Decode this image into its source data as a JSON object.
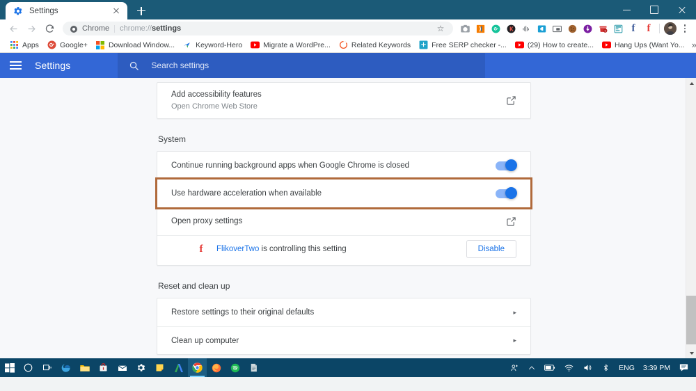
{
  "window": {
    "tab": {
      "title": "Settings",
      "favicon": "gear-icon"
    },
    "new_tab_label": "+",
    "controls": {
      "minimize": "–",
      "maximize": "❐",
      "close": "×"
    }
  },
  "toolbar": {
    "back": "back-arrow",
    "forward": "forward-arrow",
    "reload": "reload-arrow",
    "omnibox": {
      "scheme_label": "Chrome",
      "url_prefix": "chrome://",
      "url_bold": "settings",
      "full_url": "chrome://settings",
      "star": "☆"
    },
    "extensions": [
      {
        "name": "camera-extension-icon",
        "glyph": "📷",
        "color": "#9aa0a6"
      },
      {
        "name": "orange-extension-icon",
        "glyph": "",
        "color": "#f57c00"
      },
      {
        "name": "grammarly-extension-icon",
        "glyph": "G",
        "color": "#15c39a"
      },
      {
        "name": "dark-circle-extension-icon",
        "glyph": "K",
        "color": "#202124"
      },
      {
        "name": "audio-wave-extension-icon",
        "glyph": "",
        "color": "#5f6368"
      },
      {
        "name": "send-to-device-extension-icon",
        "glyph": "",
        "color": "#1a9fd4"
      },
      {
        "name": "picture-in-picture-extension-icon",
        "glyph": "",
        "color": "#5f6368"
      },
      {
        "name": "cookie-extension-icon",
        "glyph": "",
        "color": "#a0522d"
      },
      {
        "name": "download-extension-icon",
        "glyph": "↓",
        "color": "#7b1fa2"
      },
      {
        "name": "red-badge-extension-icon",
        "glyph": "",
        "color": "#d32f2f"
      },
      {
        "name": "blue-form-extension-icon",
        "glyph": "",
        "color": "#2196a6"
      },
      {
        "name": "facebook-f-extension-icon",
        "glyph": "f",
        "color": "#3b5998"
      },
      {
        "name": "flikover-f-extension-icon",
        "glyph": "f",
        "color": "#e53935"
      }
    ],
    "avatar": "user-avatar",
    "menu": "three-dot-menu"
  },
  "bookmarks": {
    "items": [
      {
        "label": "Apps",
        "icon": "apps-grid-icon"
      },
      {
        "label": "Google+",
        "icon": "google-plus-icon"
      },
      {
        "label": "Download Window...",
        "icon": "microsoft-windows-icon"
      },
      {
        "label": "Keyword-Hero",
        "icon": "keyword-hero-icon"
      },
      {
        "label": "Migrate a WordPre...",
        "icon": "youtube-icon"
      },
      {
        "label": "Related Keywords",
        "icon": "orange-ring-icon"
      },
      {
        "label": "Free SERP checker -...",
        "icon": "serp-checker-icon"
      },
      {
        "label": "(29) How to create...",
        "icon": "youtube-icon"
      },
      {
        "label": "Hang Ups (Want Yo...",
        "icon": "youtube-icon"
      }
    ],
    "overflow": "»"
  },
  "settings_header": {
    "menu_icon": "hamburger-menu-icon",
    "title": "Settings",
    "search": {
      "icon": "search-icon",
      "placeholder": "Search settings",
      "value": ""
    }
  },
  "page": {
    "accessibility_card": {
      "title": "Add accessibility features",
      "subtitle": "Open Chrome Web Store",
      "action_icon": "external-link-icon"
    },
    "system": {
      "section_title": "System",
      "rows": [
        {
          "title": "Continue running background apps when Google Chrome is closed",
          "control": "toggle",
          "toggle_on": true,
          "highlighted": false
        },
        {
          "title": "Use hardware acceleration when available",
          "control": "toggle",
          "toggle_on": true,
          "highlighted": true
        },
        {
          "title": "Open proxy settings",
          "control": "external-link",
          "toggle_on": false,
          "highlighted": false
        }
      ],
      "controlled_by": {
        "icon": "flikover-f-icon",
        "extension_name": "FlikoverTwo",
        "text_suffix": " is controlling this setting",
        "button_label": "Disable"
      }
    },
    "reset": {
      "section_title": "Reset and clean up",
      "rows": [
        {
          "title": "Restore settings to their original defaults",
          "chevron": "▸"
        },
        {
          "title": "Clean up computer",
          "chevron": "▸"
        }
      ]
    }
  },
  "taskbar": {
    "items": [
      {
        "name": "start-button",
        "icon": "windows-logo-icon"
      },
      {
        "name": "cortana-search",
        "icon": "circle-icon"
      },
      {
        "name": "task-view",
        "icon": "task-view-icon"
      },
      {
        "name": "edge-browser",
        "icon": "edge-icon"
      },
      {
        "name": "file-explorer",
        "icon": "folder-icon"
      },
      {
        "name": "microsoft-store",
        "icon": "store-icon"
      },
      {
        "name": "mail-app",
        "icon": "mail-icon"
      },
      {
        "name": "settings-app",
        "icon": "gear-icon"
      },
      {
        "name": "sticky-notes",
        "icon": "notes-icon"
      },
      {
        "name": "google-ads",
        "icon": "ads-icon"
      },
      {
        "name": "google-chrome",
        "icon": "chrome-icon"
      },
      {
        "name": "firefox-browser",
        "icon": "firefox-icon"
      },
      {
        "name": "spotify-app",
        "icon": "spotify-icon"
      },
      {
        "name": "document-app",
        "icon": "document-icon"
      }
    ],
    "tray": {
      "people": "people-icon",
      "show_hidden": "chevron-up-icon",
      "battery": "battery-icon",
      "network": "wifi-icon",
      "volume": "speaker-icon",
      "bluetooth": "bluetooth-icon",
      "language": "ENG",
      "time": "3:39 PM",
      "action_center": "action-center-icon"
    }
  },
  "colors": {
    "titlebar": "#1b5a77",
    "settings_header": "#3367d6",
    "highlight_border": "#b06a3b",
    "accent_blue": "#1a73e8",
    "taskbar": "#0b4566"
  }
}
